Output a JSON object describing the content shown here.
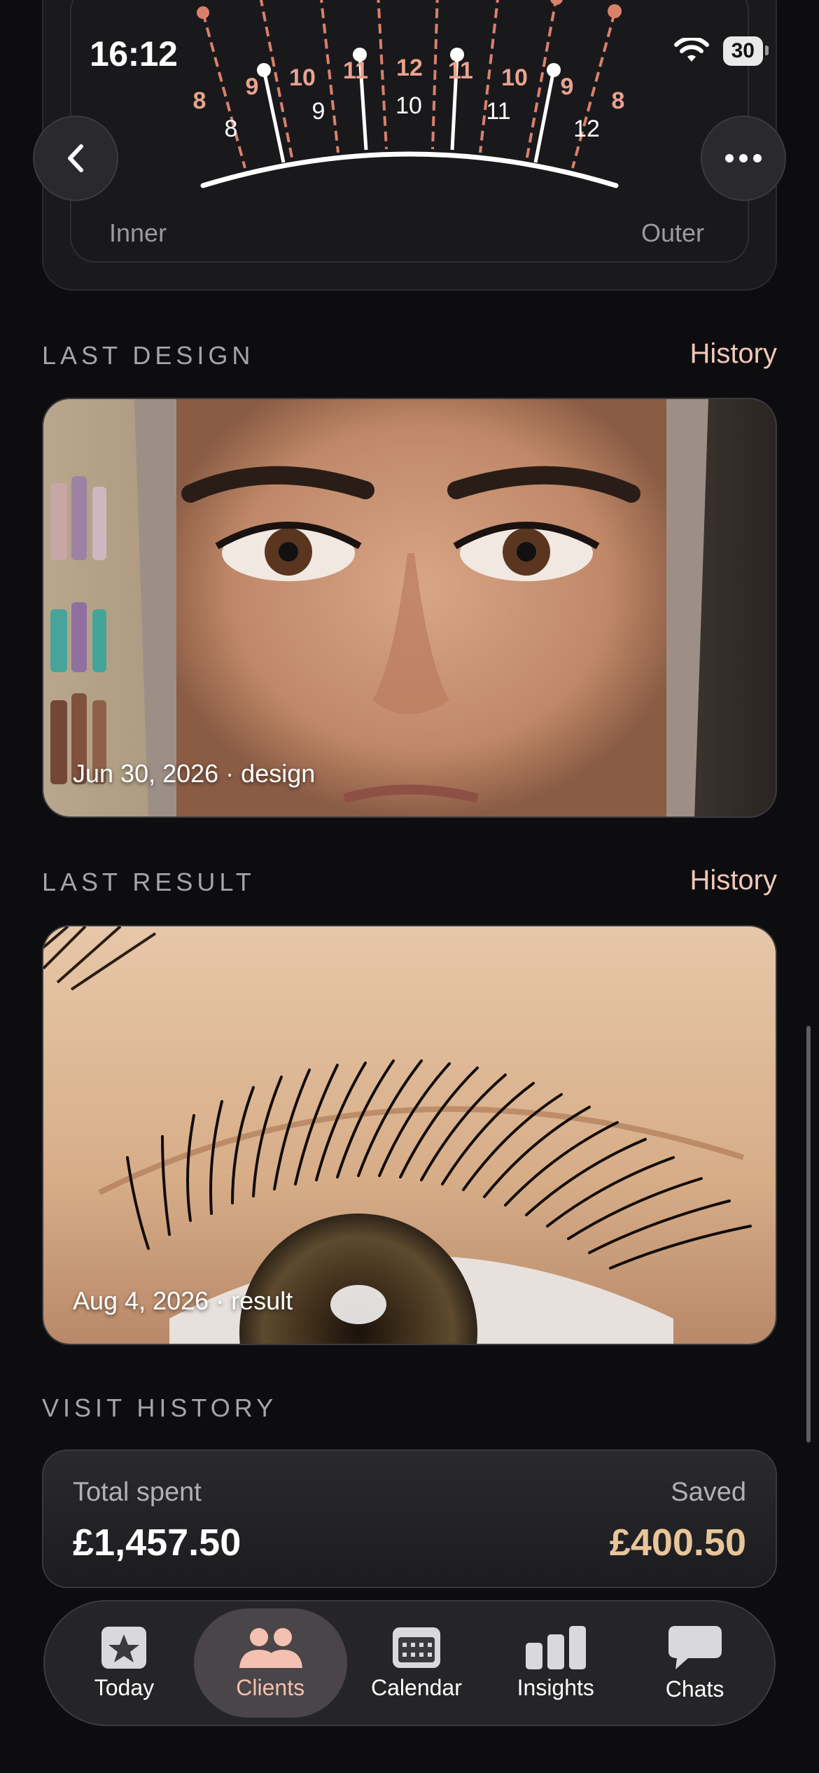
{
  "status_bar": {
    "time": "16:12",
    "battery": "30"
  },
  "lash_map": {
    "inner_label": "Inner",
    "outer_label": "Outer",
    "lengths_design": [
      "8",
      "9",
      "10",
      "11",
      "12",
      "11",
      "10",
      "9",
      "8"
    ],
    "lengths_white": [
      "8",
      "9",
      "10",
      "11",
      "12"
    ],
    "lengths_rose": [
      "8",
      "9",
      "10",
      "11",
      "12",
      "11",
      "10",
      "9",
      "8"
    ],
    "lengths_white_row": [
      "8",
      "9",
      "10",
      "11",
      "12"
    ]
  },
  "sections": {
    "last_design": {
      "title": "LAST DESIGN",
      "history": "History",
      "caption": "Jun 30, 2026 · design"
    },
    "last_result": {
      "title": "LAST RESULT",
      "history": "History",
      "caption": "Aug 4, 2026 · result"
    },
    "visit_history": {
      "title": "VISIT HISTORY",
      "total_spent_label": "Total spent",
      "total_spent_value": "£1,457.50",
      "saved_label": "Saved",
      "saved_value": "£400.50"
    }
  },
  "tabs": [
    {
      "label": "Today",
      "icon": "star-square-icon"
    },
    {
      "label": "Clients",
      "icon": "people-icon"
    },
    {
      "label": "Calendar",
      "icon": "calendar-icon"
    },
    {
      "label": "Insights",
      "icon": "bar-chart-icon"
    },
    {
      "label": "Chats",
      "icon": "chat-bubble-icon"
    }
  ],
  "colors": {
    "accent": "#f1c7b8",
    "rose": "#d9806b",
    "gold": "#e8c59a",
    "background": "#0d0d0f"
  }
}
